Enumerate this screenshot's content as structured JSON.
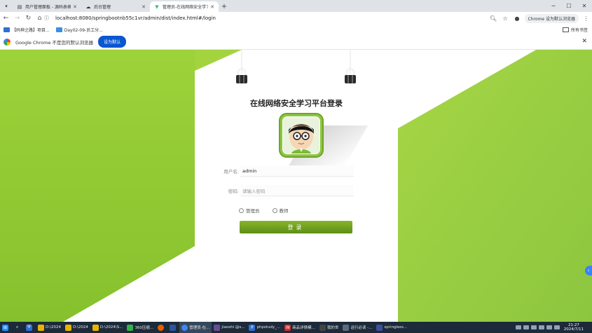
{
  "browser": {
    "tabs": [
      {
        "title": "用户管理面板 - 源码表格 javaf",
        "icon": "document-icon",
        "active": false
      },
      {
        "title": "后台管理",
        "icon": "cloud-icon",
        "active": false
      },
      {
        "title": "管理员-在线网络安全学习平台",
        "icon": "vue-icon",
        "active": true
      }
    ],
    "url": "localhost:8080/springbootnb55c1vr/admin/dist/index.html#/login",
    "profile_label": "Chrome 设为默认浏览器",
    "bookmarks": [
      {
        "label": "【码神之路】项目...",
        "color": "#2f6fd6"
      },
      {
        "label": "Day02-09-员工分...",
        "color": "#3a8ee6"
      }
    ],
    "bookmarks_folder": "所有书签"
  },
  "infobar": {
    "message": "Google Chrome 不是您的默认浏览器",
    "button": "设为默认"
  },
  "login": {
    "title": "在线网络安全学习平台登录",
    "username_label": "用户名:",
    "username_value": "admin",
    "password_label": "密码:",
    "password_placeholder": "请输入密码",
    "roles": [
      "管理员",
      "教师"
    ],
    "submit_label": "登录"
  },
  "colors": {
    "accent_green": "#8cc63f",
    "button_blue": "#0b57d0"
  },
  "taskbar": {
    "items": [
      {
        "label": "D:\\2024",
        "color": "#e8b400"
      },
      {
        "label": "D:\\2024",
        "color": "#e8b400"
      },
      {
        "label": "D:\\2024\\S...",
        "color": "#e8b400"
      },
      {
        "label": "360压缩...",
        "color": "#35b04a"
      },
      {
        "label": "管理员-在...",
        "color": "#4285f4"
      },
      {
        "label": "jiaoshi @s...",
        "color": "#6a4c93"
      },
      {
        "label": "phpstudy_...",
        "color": "#2f6fd6"
      },
      {
        "label": "商品详情模...",
        "color": "#d62828"
      },
      {
        "label": "我的世",
        "color": "#444444"
      },
      {
        "label": "运行必读 -...",
        "color": "#5a6b7d"
      },
      {
        "label": "springboo...",
        "color": "#3a4fa0"
      }
    ],
    "time": "21:27",
    "date": "2024/7/11"
  }
}
